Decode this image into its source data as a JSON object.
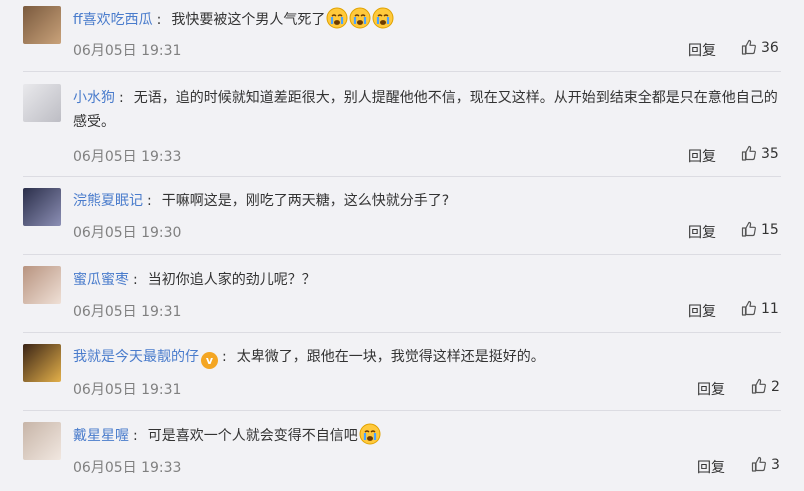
{
  "ui": {
    "reply_label": "回复"
  },
  "comments": [
    {
      "user": "ff喜欢吃西瓜",
      "text": "我快要被这个男人气死了",
      "emoji_count": 3,
      "time": "06月05日 19:31",
      "likes": "36",
      "verified": false
    },
    {
      "user": "小水狗",
      "text": "无语，追的时候就知道差距很大，别人提醒他他不信，现在又这样。从开始到结束全都是只在意他自己的感受。",
      "emoji_count": 0,
      "time": "06月05日 19:33",
      "likes": "35",
      "verified": false
    },
    {
      "user": "浣熊夏眠记",
      "text": "干嘛啊这是，刚吃了两天糖，这么快就分手了?",
      "emoji_count": 0,
      "time": "06月05日 19:30",
      "likes": "15",
      "verified": false
    },
    {
      "user": "蜜瓜蜜枣",
      "text": "当初你追人家的劲儿呢？？",
      "emoji_count": 0,
      "time": "06月05日 19:31",
      "likes": "11",
      "verified": false
    },
    {
      "user": "我就是今天最靓的仔",
      "text": "太卑微了，跟他在一块，我觉得这样还是挺好的。",
      "emoji_count": 0,
      "time": "06月05日 19:31",
      "likes": "2",
      "verified": true
    },
    {
      "user": "戴星星喔",
      "text": "可是喜欢一个人就会变得不自信吧",
      "emoji_count": 1,
      "time": "06月05日 19:33",
      "likes": "3",
      "verified": false
    }
  ]
}
